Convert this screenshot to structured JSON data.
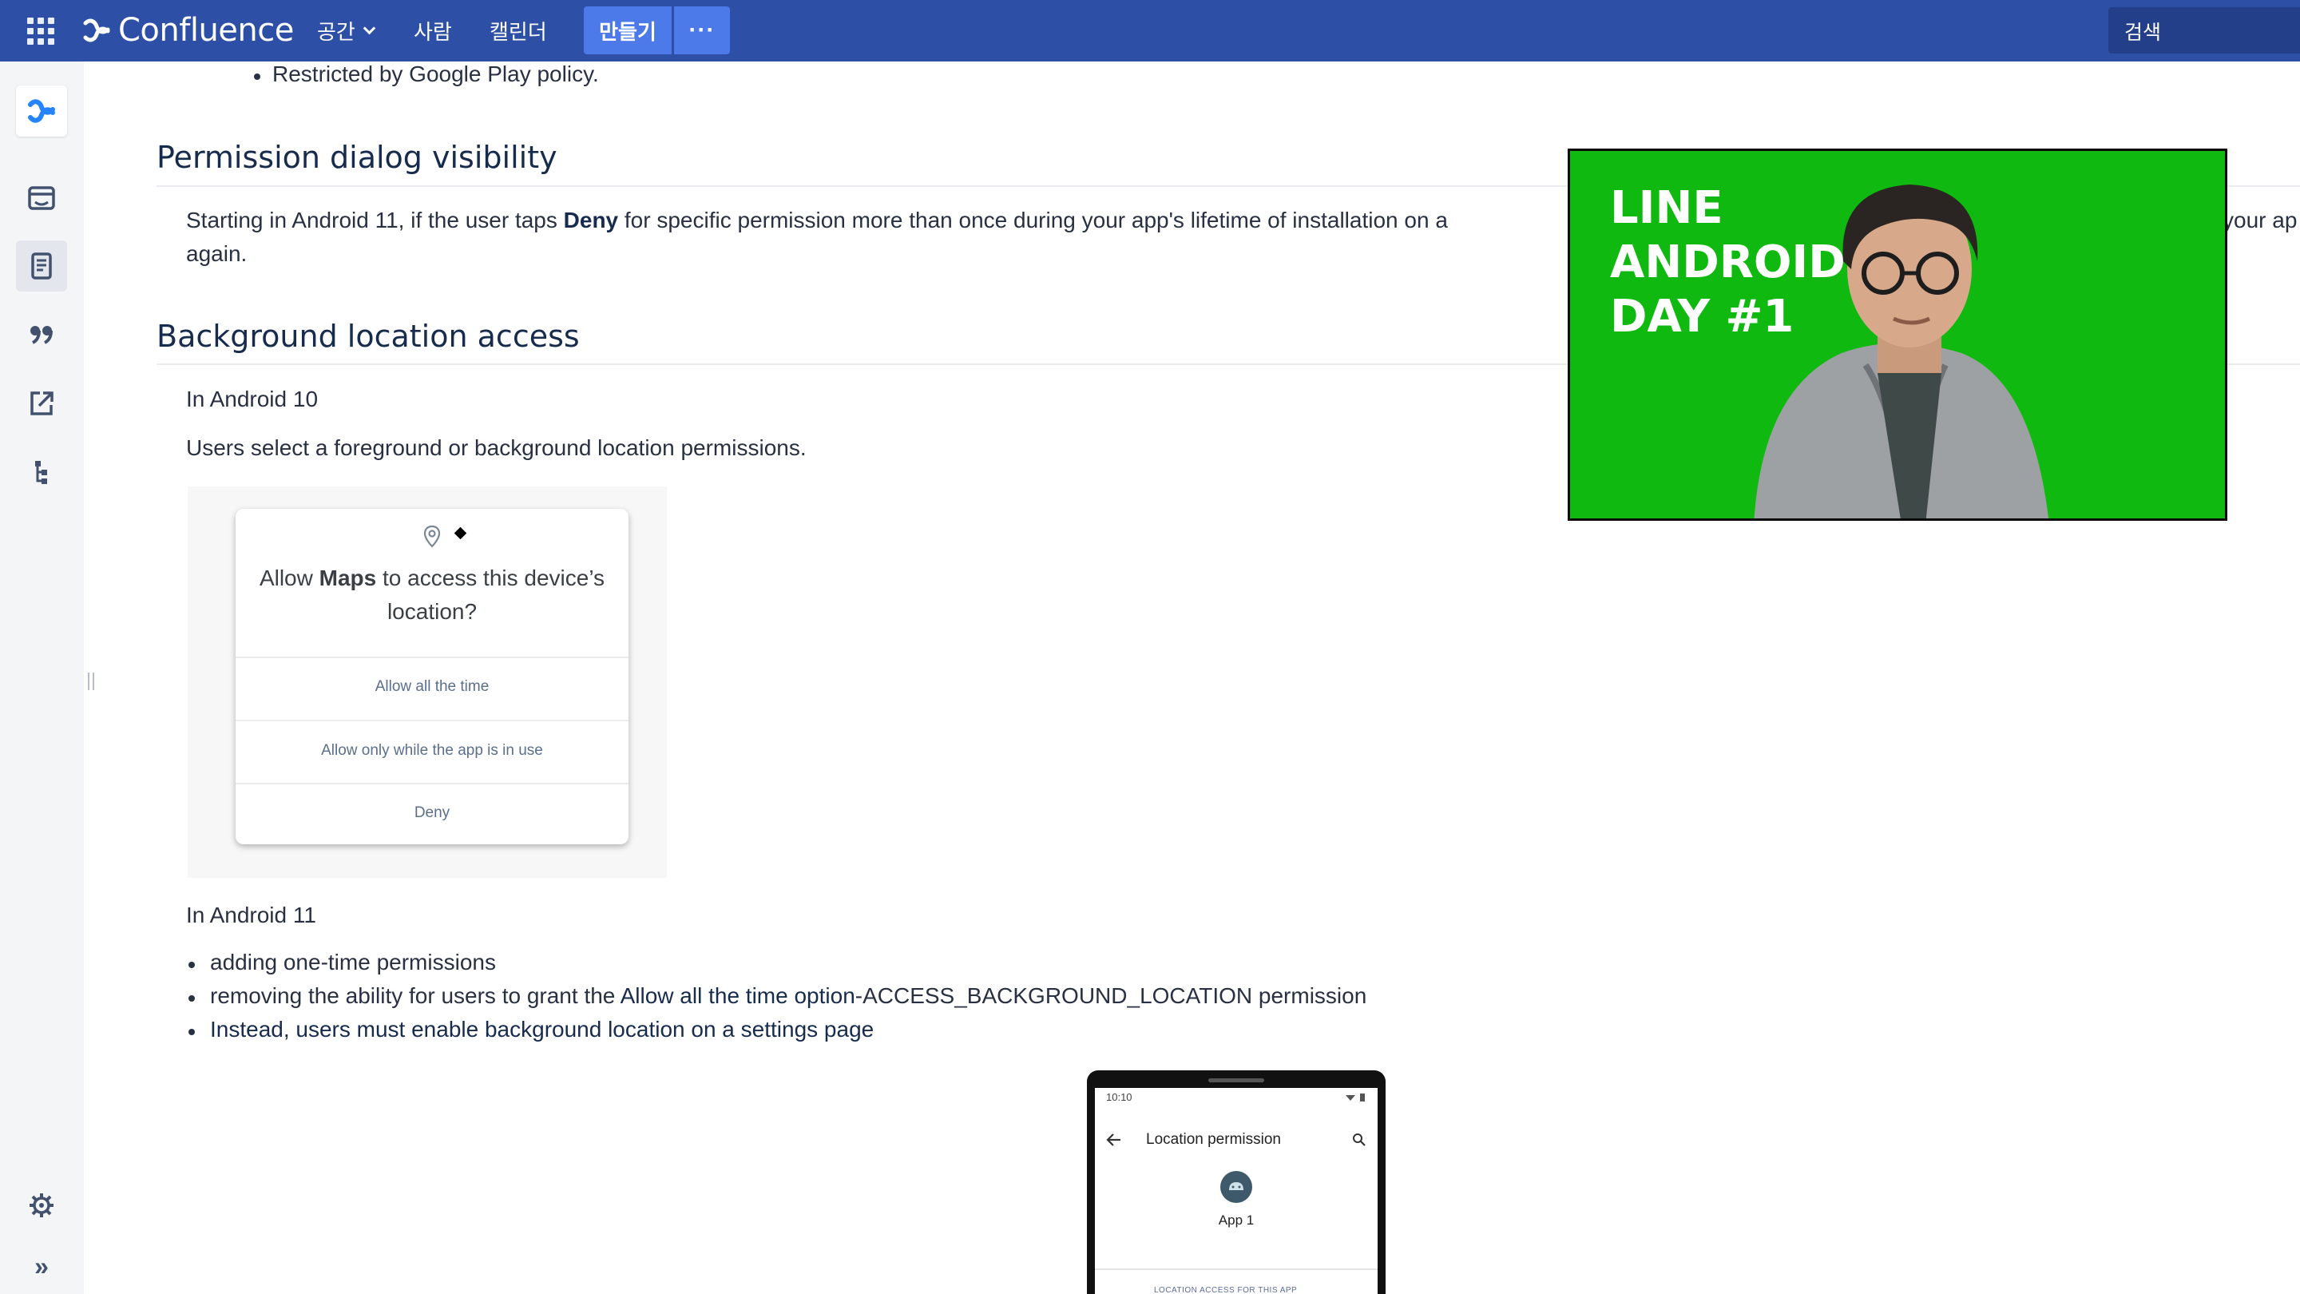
{
  "topnav": {
    "brand": "Confluence",
    "items": [
      {
        "label": "공간"
      },
      {
        "label": "사람"
      },
      {
        "label": "캘린더"
      }
    ],
    "create_label": "만들기",
    "more_label": "···",
    "search_placeholder": "검색"
  },
  "sidebar": {
    "icons": [
      "confluence-logo-icon",
      "calendar-icon",
      "page-icon",
      "quote-icon",
      "external-link-icon",
      "tree-icon",
      "settings-icon",
      "expand-icon"
    ],
    "expand_label": "»"
  },
  "content": {
    "top_bullet": "Restricted by Google Play policy.",
    "h_permission": "Permission dialog visibility",
    "permission_p1_pre": "Starting in Android 11, if the user taps ",
    "permission_p1_bold": "Deny",
    "permission_p1_post": " for specific permission more than once during your app's lifetime of installation on a",
    "permission_p1_tail": "your ap",
    "permission_p2": "again.",
    "h_background": "Background location access",
    "android10_label": "In Android 10",
    "android10_desc": "Users select a foreground or background location permissions.",
    "dialog": {
      "title_pre": "Allow ",
      "title_bold": "Maps",
      "title_post": " to access this device’s location?",
      "options": [
        "Allow all the time",
        "Allow only while the app is in use",
        "Deny"
      ]
    },
    "android11_label": "In Android 11",
    "android11_bullets": [
      {
        "pre": "adding one-time permissions",
        "dark": "",
        "post": ""
      },
      {
        "pre": "removing the ability for users to grant the ",
        "dark": "Allow all the time option",
        "post": "-ACCESS_BACKGROUND_LOCATION permission"
      },
      {
        "pre": "",
        "dark": "Instead, users must enable background location on a settings page",
        "post": ""
      }
    ],
    "phone": {
      "time": "10:10",
      "title": "Location permission",
      "app_name": "App 1",
      "section": "LOCATION ACCESS FOR THIS APP"
    }
  },
  "video": {
    "title": "LINE\nANDROID\nDAY #1"
  },
  "colors": {
    "topnav_bg": "#2d4fa6",
    "create_bg": "#4c7ae8",
    "sidebar_bg": "#f4f5f7",
    "video_bg": "#0fb90f",
    "confluence_blue": "#2684ff"
  }
}
